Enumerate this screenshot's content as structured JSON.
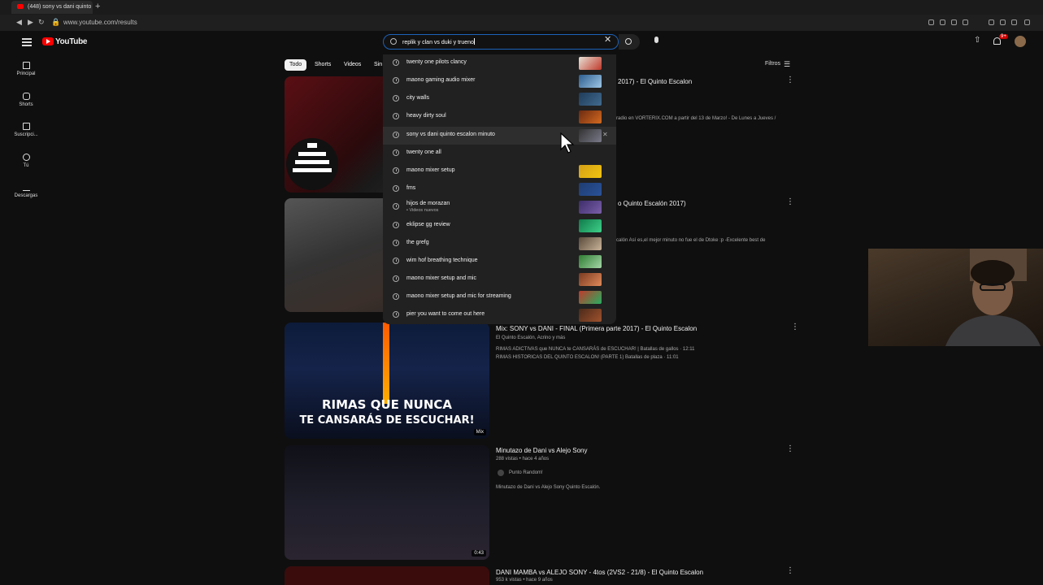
{
  "browser": {
    "tab_title": "(448) sony vs dani quinto",
    "new_tab": "+",
    "url": "www.youtube.com/results"
  },
  "header": {
    "logo": "YouTube",
    "search_value": "replik y clan vs duki y trueno",
    "notifications_badge": "9+"
  },
  "sidebar": {
    "items": [
      {
        "label": "Principal",
        "icon": "home-icon"
      },
      {
        "label": "Shorts",
        "icon": "shorts-icon"
      },
      {
        "label": "Suscripci...",
        "icon": "subscriptions-icon"
      },
      {
        "label": "Tú",
        "icon": "you-icon"
      },
      {
        "label": "Descargas",
        "icon": "download-icon"
      }
    ]
  },
  "chips": [
    {
      "label": "Todo",
      "active": true
    },
    {
      "label": "Shorts",
      "active": false
    },
    {
      "label": "Videos",
      "active": false
    },
    {
      "label": "Sin",
      "active": false
    }
  ],
  "filters_label": "Filtros",
  "suggestions": [
    {
      "text": "twenty one pilots clancy"
    },
    {
      "text": "maono gaming audio mixer"
    },
    {
      "text": "city walls"
    },
    {
      "text": "heavy dirty soul"
    },
    {
      "text": "sony vs dani quinto escalon minuto"
    },
    {
      "text": "twenty one all"
    },
    {
      "text": "maono mixer setup"
    },
    {
      "text": "fms"
    },
    {
      "text": "hijos de morazan",
      "sub": "• Videos nuevos"
    },
    {
      "text": "eklipse gg review"
    },
    {
      "text": "the grefg"
    },
    {
      "text": "wim hof breathing technique"
    },
    {
      "text": "maono mixer setup and mic"
    },
    {
      "text": "maono mixer setup and mic for streaming"
    },
    {
      "text": "pier you want to come out here"
    }
  ],
  "results": [
    {
      "title_visible": "2017) - El Quinto Escalon",
      "desc_visible": "radio en VORTERIX.COM a partir del 13 de Marzo! - De Lunes a Jueves /"
    },
    {
      "title_visible": "o Quinto Escalón 2017)",
      "desc_visible": "calón Así es,el mejor minuto no fue el de Dtoke :p -Excelente best de"
    },
    {
      "title": "Mix: SONY vs DANI - FINAL (Primera parte 2017) - El Quinto Escalon",
      "meta": "El Quinto Escalón, Acrino y más",
      "desc1": "RIMAS ADICTIVAS que NUNCA te CANSARÁS de ESCUCHAR! | Batallas de gallos · 12:11",
      "desc2": "RIMAS HISTORICAS DEL QUINTO ESCALON! (PARTE 1) Batallas de plaza · 11:01",
      "thumb_text1": "RIMAS QUE NUNCA",
      "thumb_text2": "TE CANSARÁS DE ESCUCHAR!",
      "badge": "Mix"
    },
    {
      "title": "Minutazo de Dani vs Alejo Sony",
      "meta": "288 vistas • hace 4 años",
      "channel": "Punto Random!",
      "desc": "Minutazo de Dani vs Alejo Sony Quinto Escalón.",
      "duration": "0:43"
    },
    {
      "title": "DANI MAMBA vs ALEJO SONY - 4tos (2VS2 - 21/8) - El Quinto Escalon",
      "meta": "953 k vistas • hace 9 años"
    }
  ]
}
